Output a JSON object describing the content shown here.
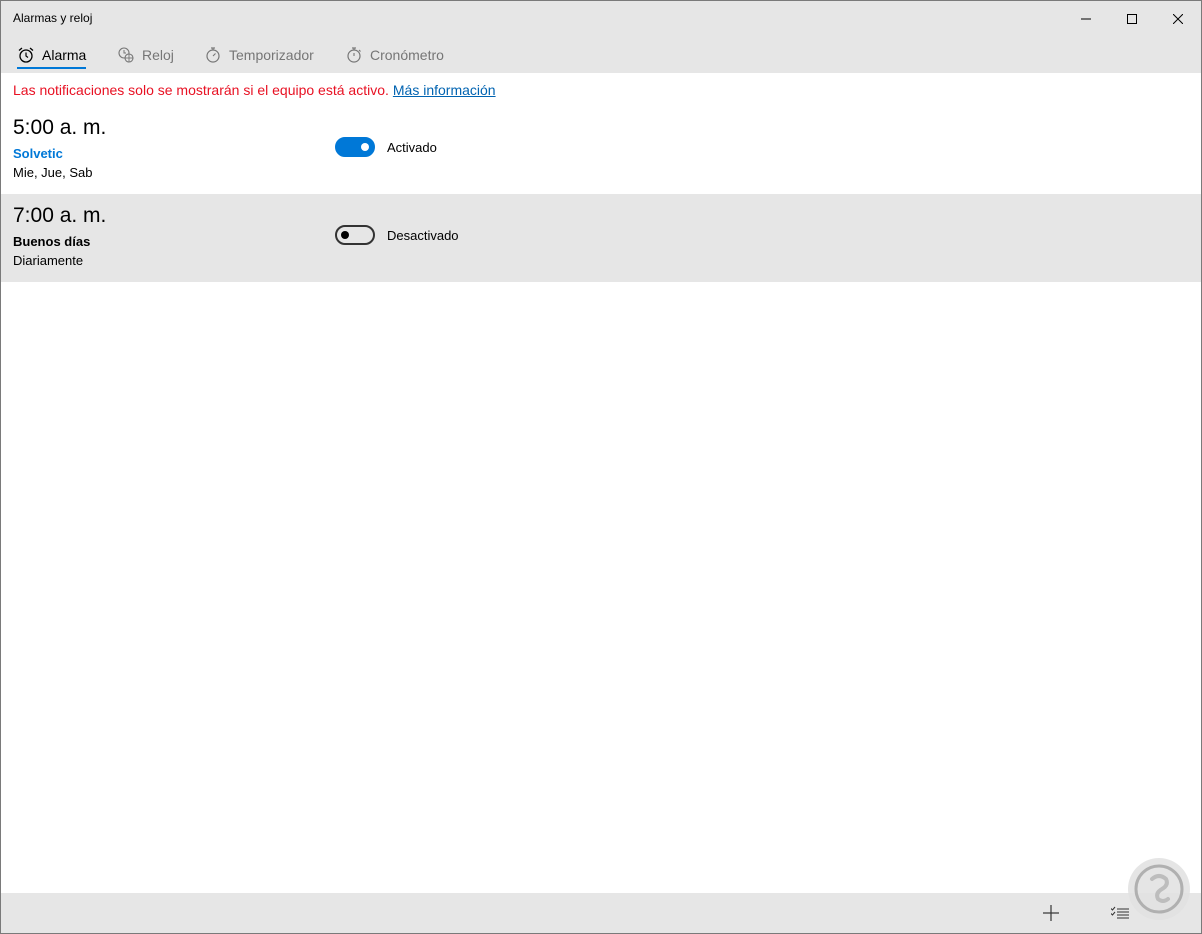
{
  "window": {
    "title": "Alarmas y reloj"
  },
  "tabs": [
    {
      "label": "Alarma",
      "icon": "alarm-clock-icon",
      "active": true
    },
    {
      "label": "Reloj",
      "icon": "world-clock-icon",
      "active": false
    },
    {
      "label": "Temporizador",
      "icon": "timer-icon",
      "active": false
    },
    {
      "label": "Cronómetro",
      "icon": "stopwatch-icon",
      "active": false
    }
  ],
  "notice": {
    "text": "Las notificaciones solo se mostrarán si el equipo está activo.",
    "link": "Más información"
  },
  "alarms": [
    {
      "time": "5:00 a. m.",
      "name": "Solvetic",
      "days": "Mie, Jue, Sab",
      "enabled": true,
      "status_label": "Activado"
    },
    {
      "time": "7:00 a. m.",
      "name": "Buenos días",
      "days": "Diariamente",
      "enabled": false,
      "status_label": "Desactivado"
    }
  ],
  "commands": {
    "add_icon": "plus-icon",
    "select_icon": "select-list-icon"
  },
  "colors": {
    "accent": "#0078d7",
    "notice": "#e81123",
    "link": "#0063b1",
    "chrome": "#e6e6e6"
  }
}
